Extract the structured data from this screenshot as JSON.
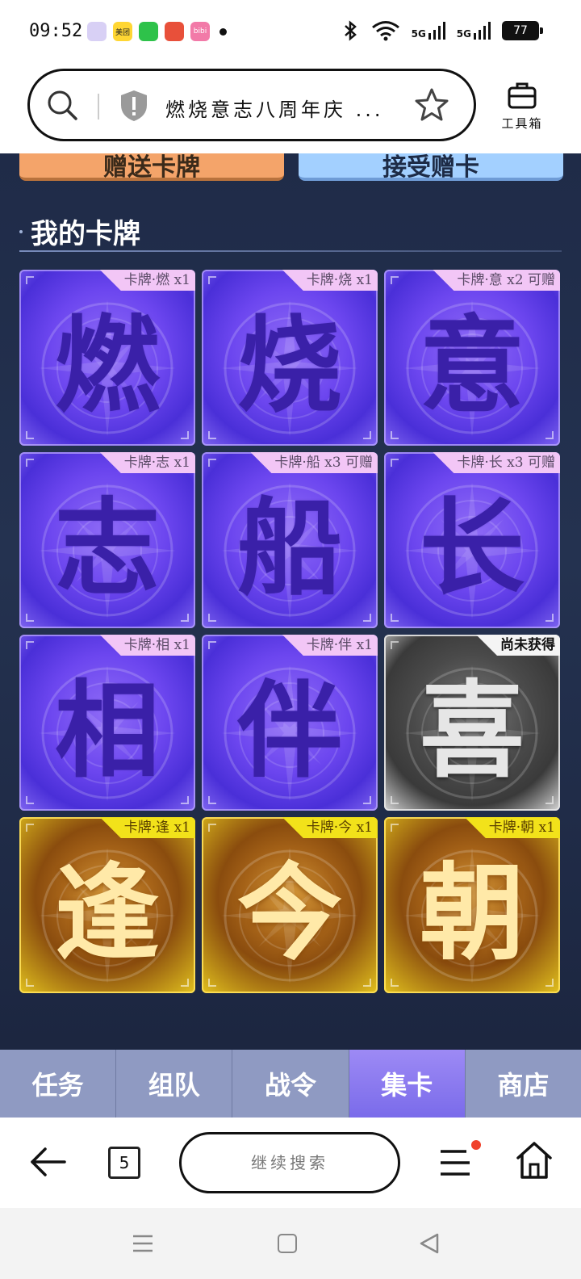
{
  "status_bar": {
    "time": "09:52",
    "apps": [
      "",
      "美团",
      "",
      "",
      "bibi"
    ],
    "network_5g_1": "5G",
    "network_5g_2": "5G",
    "battery": "77"
  },
  "address_bar": {
    "url_text": "燃烧意志八周年庆 ...",
    "toolbox_label": "工具箱"
  },
  "top_buttons": {
    "left_label": "赠送卡牌",
    "right_label": "接受赠卡"
  },
  "section": {
    "title": "我的卡牌"
  },
  "cards": [
    {
      "char": "燃",
      "tag": "卡牌·燃 x1",
      "style": "purple"
    },
    {
      "char": "烧",
      "tag": "卡牌·烧 x1",
      "style": "purple"
    },
    {
      "char": "意",
      "tag": "卡牌·意 x2 可赠",
      "style": "purple"
    },
    {
      "char": "志",
      "tag": "卡牌·志 x1",
      "style": "purple"
    },
    {
      "char": "船",
      "tag": "卡牌·船 x3 可赠",
      "style": "purple"
    },
    {
      "char": "长",
      "tag": "卡牌·长 x3 可赠",
      "style": "purple"
    },
    {
      "char": "相",
      "tag": "卡牌·相 x1",
      "style": "purple"
    },
    {
      "char": "伴",
      "tag": "卡牌·伴 x1",
      "style": "purple"
    },
    {
      "char": "喜",
      "tag": "尚未获得",
      "style": "grey"
    },
    {
      "char": "逢",
      "tag": "卡牌·逢 x1",
      "style": "gold"
    },
    {
      "char": "今",
      "tag": "卡牌·今 x1",
      "style": "gold"
    },
    {
      "char": "朝",
      "tag": "卡牌·朝 x1",
      "style": "gold"
    }
  ],
  "tabs": [
    {
      "label": "任务",
      "active": false
    },
    {
      "label": "组队",
      "active": false
    },
    {
      "label": "战令",
      "active": false
    },
    {
      "label": "集卡",
      "active": true
    },
    {
      "label": "商店",
      "active": false
    }
  ],
  "browser_nav": {
    "tab_count": "5",
    "search_label": "继续搜索"
  },
  "colors": {
    "page_bg": "#1e2a44",
    "tab_active": "#8a7af0",
    "tab_inactive": "#8f9ac2",
    "card_purple": "#6c46ef",
    "card_gold": "#e2c21e",
    "card_grey": "#4a4a4a",
    "notification_badge": "#f0412a"
  },
  "icons": {
    "search": "search-icon",
    "shield": "shield-icon",
    "star": "star-icon",
    "toolbox": "toolbox-icon",
    "back": "back-arrow-icon",
    "menu": "menu-icon",
    "home": "home-icon"
  }
}
